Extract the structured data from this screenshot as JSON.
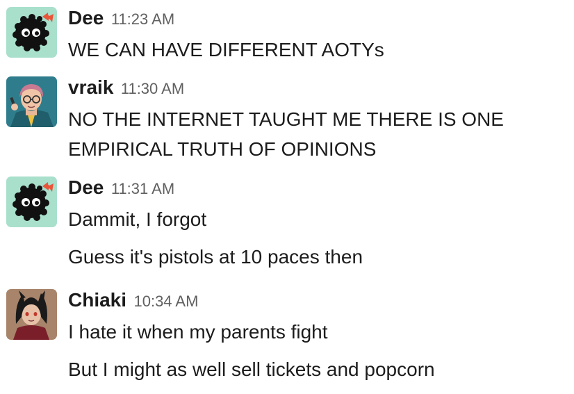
{
  "messages": [
    {
      "author": "Dee",
      "time": "11:23 AM",
      "lines": [
        "WE CAN HAVE DIFFERENT AOTYs"
      ]
    },
    {
      "author": "vraik",
      "time": "11:30 AM",
      "lines": [
        "NO THE INTERNET TAUGHT ME THERE IS ONE",
        "EMPIRICAL TRUTH OF OPINIONS"
      ]
    },
    {
      "author": "Dee",
      "time": "11:31 AM",
      "lines": [
        "Dammit, I forgot",
        "Guess it's pistols at 10 paces then"
      ]
    },
    {
      "author": "Chiaki",
      "time": "10:34 AM",
      "lines": [
        "I hate it when my parents fight",
        "But I might as well sell tickets and popcorn"
      ]
    }
  ],
  "avatars": {
    "dee": "soot-sprite-avatar",
    "vraik": "glasses-person-avatar",
    "chiaki": "dark-hair-character-avatar"
  },
  "colors": {
    "name_text": "#1d1c1d",
    "timestamp_text": "#616061",
    "body_text": "#1d1c1d",
    "dee_avatar_bg": "#a8e0cc",
    "vraik_avatar_bg": "#2f7d8c",
    "chiaki_avatar_bg": "#a8846a"
  }
}
